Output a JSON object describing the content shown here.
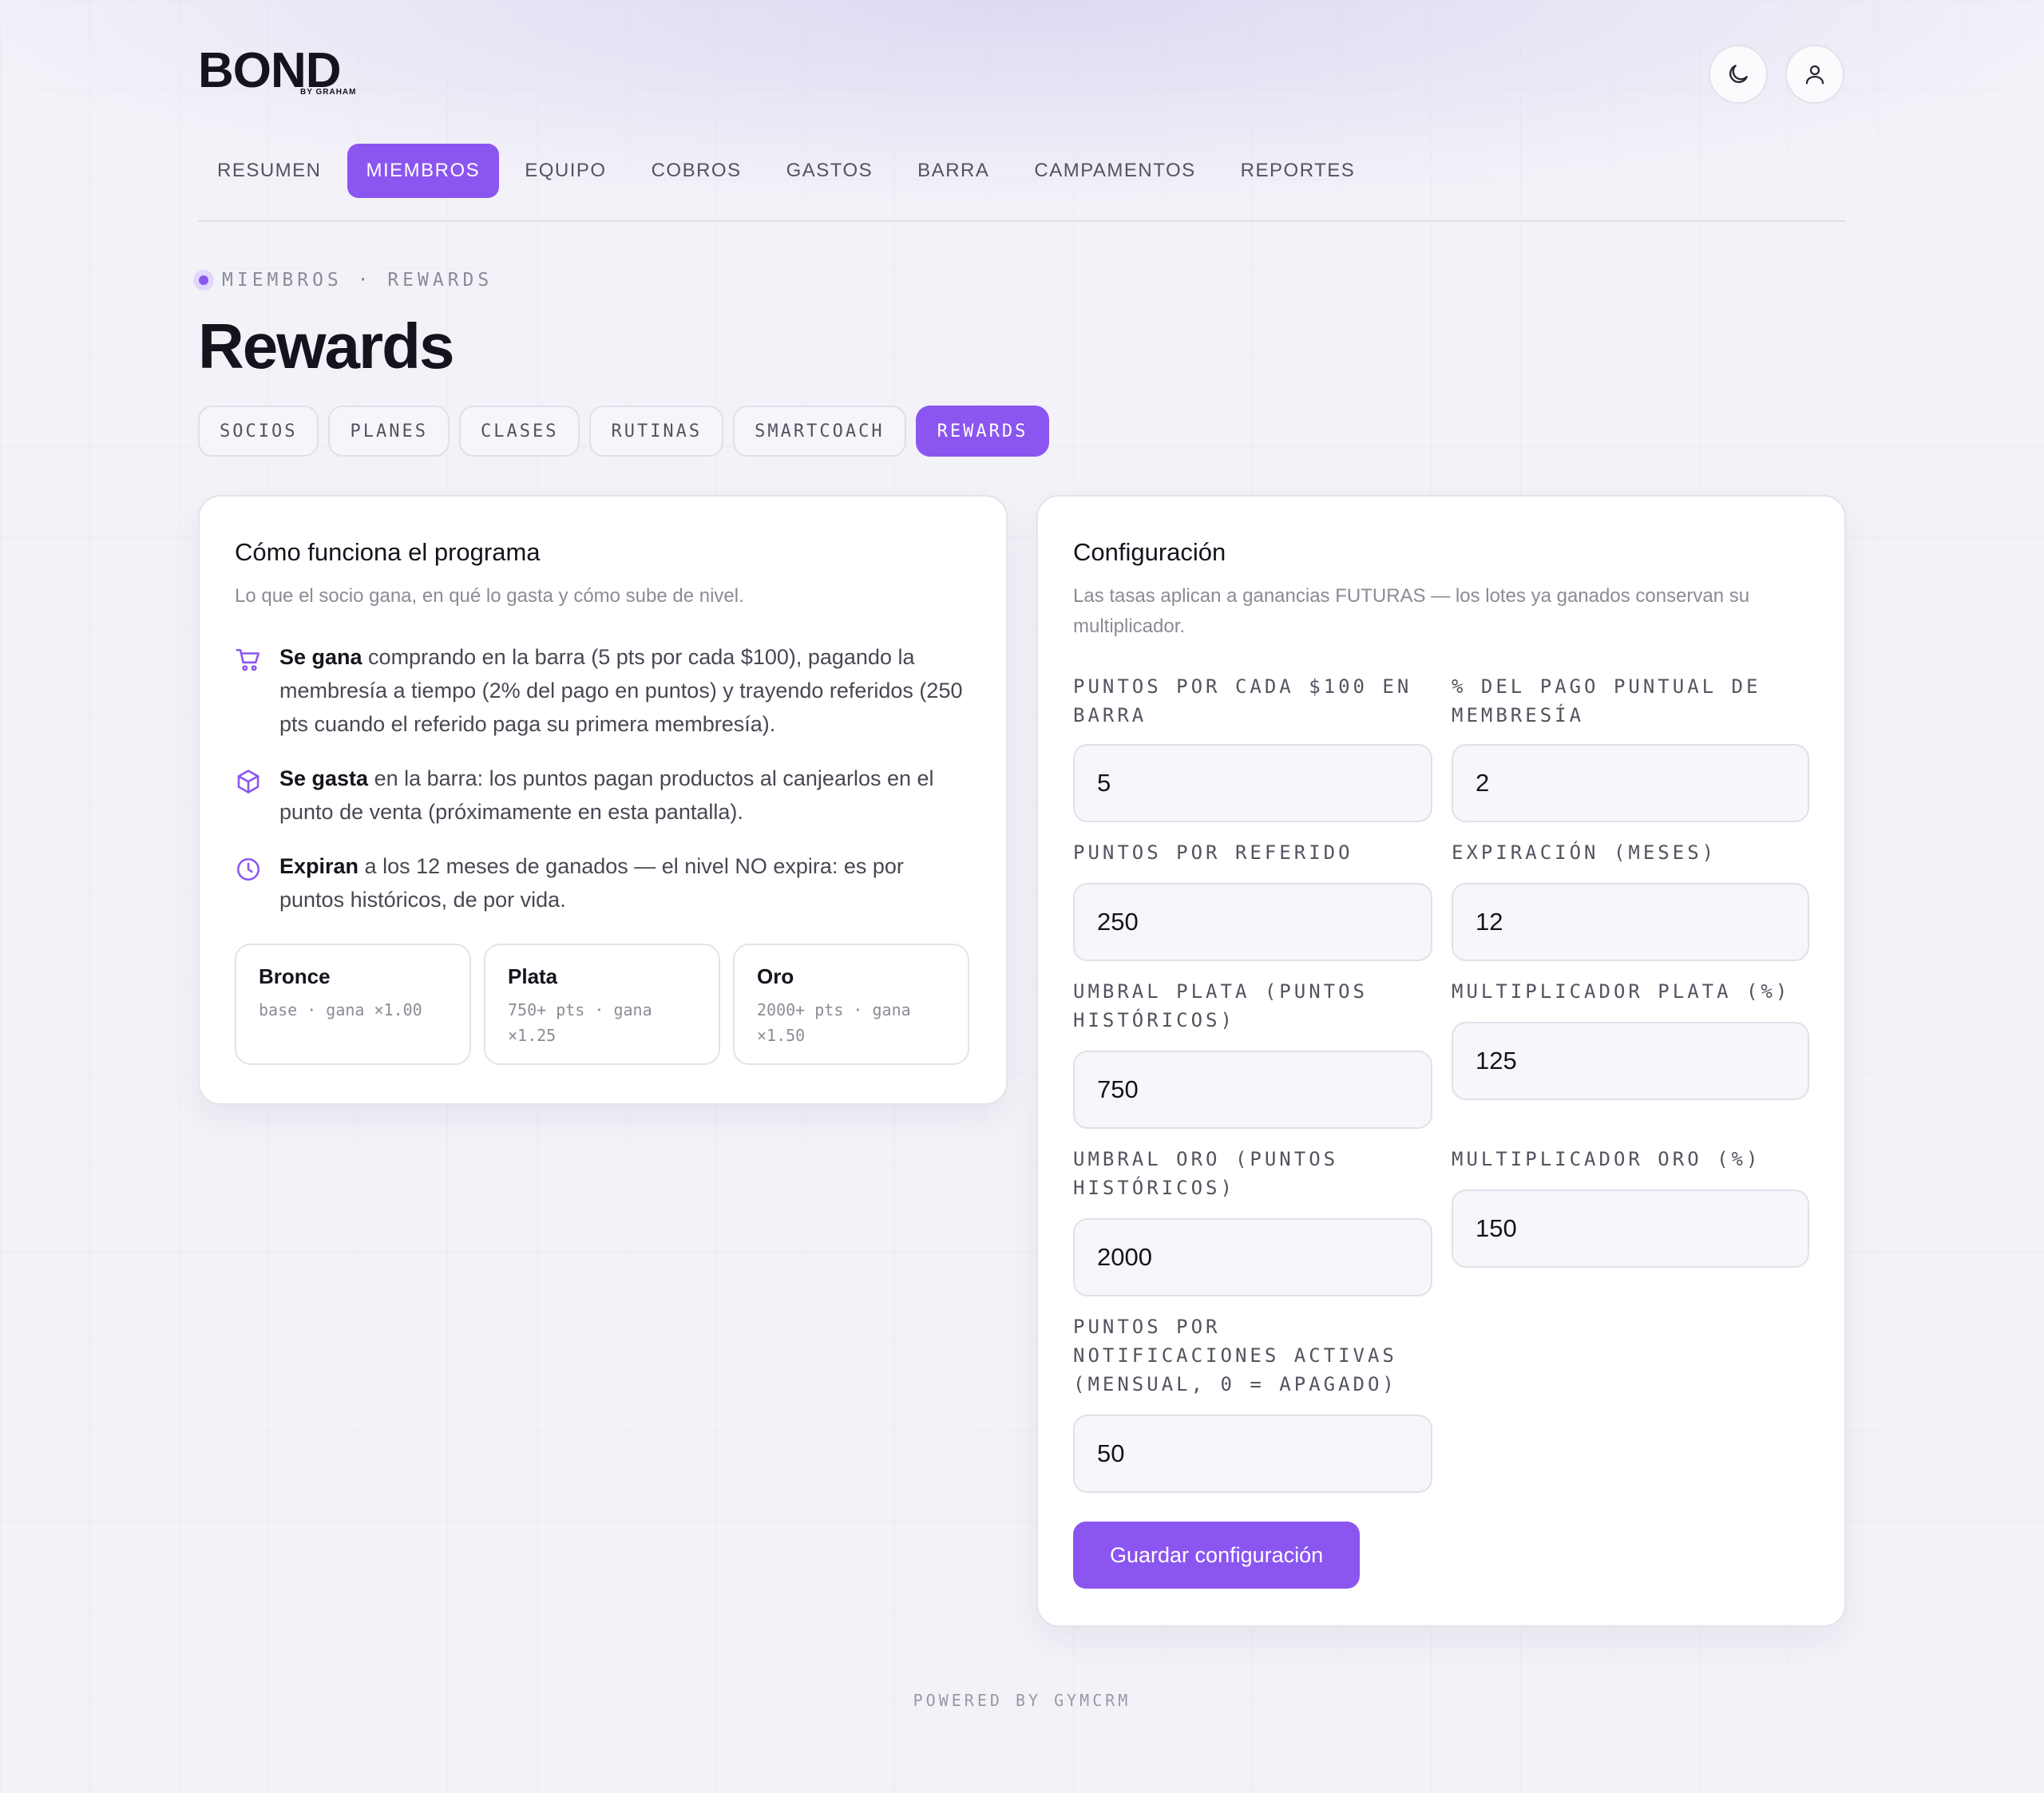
{
  "brand": {
    "logo": "BOND",
    "sub": "BY GRAHAM"
  },
  "header": {
    "theme_icon": "moon-icon",
    "profile_icon": "user-icon"
  },
  "nav": {
    "items": [
      {
        "label": "RESUMEN"
      },
      {
        "label": "MIEMBROS",
        "active": true
      },
      {
        "label": "EQUIPO"
      },
      {
        "label": "COBROS"
      },
      {
        "label": "GASTOS"
      },
      {
        "label": "BARRA"
      },
      {
        "label": "CAMPAMENTOS"
      },
      {
        "label": "REPORTES"
      }
    ]
  },
  "breadcrumb": "MIEMBROS · REWARDS",
  "page_title": "Rewards",
  "subtabs": [
    {
      "label": "SOCIOS"
    },
    {
      "label": "PLANES"
    },
    {
      "label": "CLASES"
    },
    {
      "label": "RUTINAS"
    },
    {
      "label": "SMARTCOACH"
    },
    {
      "label": "REWARDS",
      "active": true
    }
  ],
  "program": {
    "title": "Cómo funciona el programa",
    "subtitle": "Lo que el socio gana, en qué lo gasta y cómo sube de nivel.",
    "rules": [
      {
        "icon": "cart-icon",
        "bold": "Se gana",
        "text": " comprando en la barra (5 pts por cada $100), pagando la membresía a tiempo (2% del pago en puntos) y trayendo referidos (250 pts cuando el referido paga su primera membresía)."
      },
      {
        "icon": "box-icon",
        "bold": "Se gasta",
        "text": " en la barra: los puntos pagan productos al canjearlos en el punto de venta (próximamente en esta pantalla)."
      },
      {
        "icon": "clock-icon",
        "bold": "Expiran",
        "text": " a los 12 meses de ganados — el nivel NO expira: es por puntos históricos, de por vida."
      }
    ],
    "tiers": [
      {
        "name": "Bronce",
        "desc": "base · gana ×1.00"
      },
      {
        "name": "Plata",
        "desc": "750+ pts · gana ×1.25"
      },
      {
        "name": "Oro",
        "desc": "2000+ pts · gana ×1.50"
      }
    ]
  },
  "config": {
    "title": "Configuración",
    "subtitle": "Las tasas aplican a ganancias FUTURAS — los lotes ya ganados conservan su multiplicador.",
    "fields": {
      "bar_points": {
        "label": "PUNTOS POR CADA $100 EN BARRA",
        "value": "5"
      },
      "punctual_pct": {
        "label": "% DEL PAGO PUNTUAL DE MEMBRESÍA",
        "value": "2"
      },
      "referral_points": {
        "label": "PUNTOS POR REFERIDO",
        "value": "250"
      },
      "expiration": {
        "label": "EXPIRACIÓN (MESES)",
        "value": "12"
      },
      "silver_threshold": {
        "label": "UMBRAL PLATA (PUNTOS HISTÓRICOS)",
        "value": "750"
      },
      "silver_mult": {
        "label": "MULTIPLICADOR PLATA (%)",
        "value": "125"
      },
      "gold_threshold": {
        "label": "UMBRAL ORO (PUNTOS HISTÓRICOS)",
        "value": "2000"
      },
      "gold_mult": {
        "label": "MULTIPLICADOR ORO (%)",
        "value": "150"
      },
      "notif_points": {
        "label": "PUNTOS POR NOTIFICACIONES ACTIVAS (MENSUAL, 0 = APAGADO)",
        "value": "50"
      }
    },
    "save_label": "Guardar configuración"
  },
  "footer": "POWERED BY GYMCRM",
  "colors": {
    "accent": "#8b55f0",
    "background": "#f3f2f8"
  }
}
